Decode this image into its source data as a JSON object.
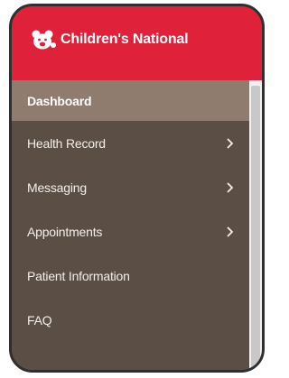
{
  "brand": {
    "name": "Children's National",
    "header_color": "#e0213a"
  },
  "menu": {
    "items": [
      {
        "label": "Dashboard",
        "has_submenu": false,
        "active": true
      },
      {
        "label": "Health Record",
        "has_submenu": true,
        "active": false
      },
      {
        "label": "Messaging",
        "has_submenu": true,
        "active": false
      },
      {
        "label": "Appointments",
        "has_submenu": true,
        "active": false
      },
      {
        "label": "Patient Information",
        "has_submenu": false,
        "active": false
      },
      {
        "label": "FAQ",
        "has_submenu": false,
        "active": false
      }
    ],
    "chevron_icon": "chevron-right-icon",
    "background_color": "#5b4e45",
    "active_color": "#8f7c6e"
  }
}
